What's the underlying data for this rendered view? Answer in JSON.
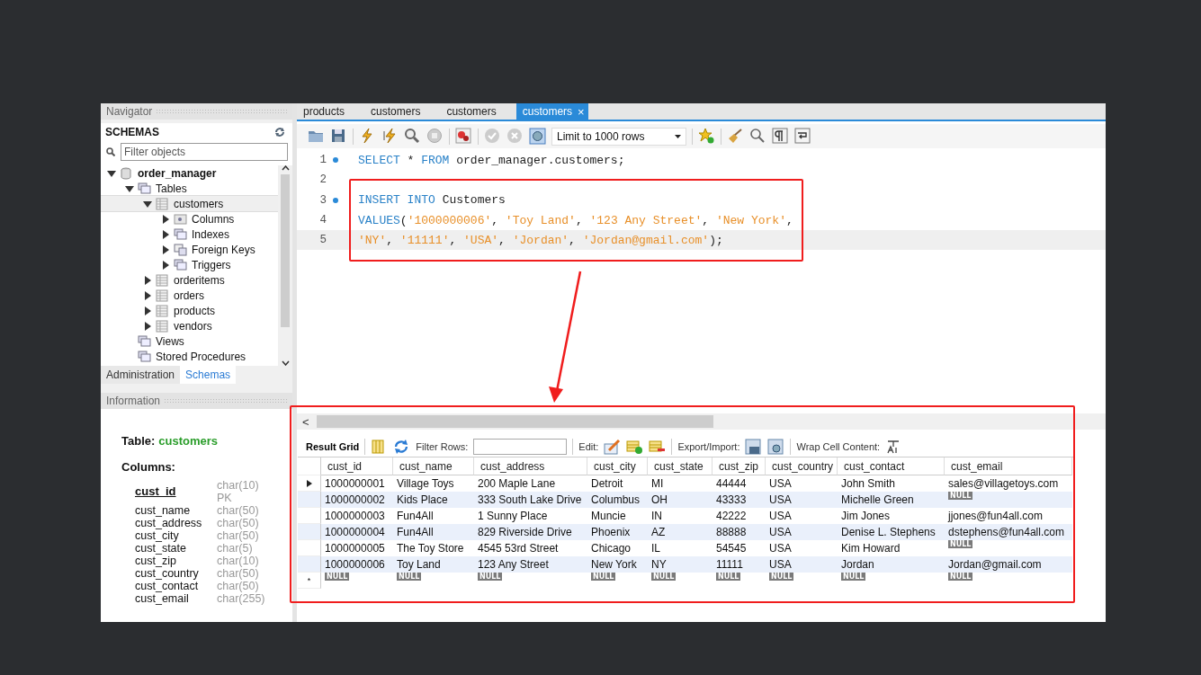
{
  "navigator": {
    "title": "Navigator",
    "section": "SCHEMAS",
    "filter": {
      "placeholder": "Filter objects"
    },
    "tree": [
      {
        "label": "order_manager",
        "kind": "schema",
        "expanded": true,
        "selected": false,
        "children": [
          {
            "label": "Tables",
            "kind": "folder",
            "expanded": true,
            "selected": false,
            "children": [
              {
                "label": "customers",
                "kind": "table",
                "expanded": true,
                "selected": true,
                "children": [
                  {
                    "label": "Columns",
                    "kind": "columns",
                    "expanded": false,
                    "selected": false
                  },
                  {
                    "label": "Indexes",
                    "kind": "folder",
                    "expanded": false,
                    "selected": false
                  },
                  {
                    "label": "Foreign Keys",
                    "kind": "keys",
                    "expanded": false,
                    "selected": false
                  },
                  {
                    "label": "Triggers",
                    "kind": "folder",
                    "expanded": false,
                    "selected": false
                  }
                ]
              },
              {
                "label": "orderitems",
                "kind": "table",
                "expanded": false,
                "selected": false
              },
              {
                "label": "orders",
                "kind": "table",
                "expanded": false,
                "selected": false
              },
              {
                "label": "products",
                "kind": "table",
                "expanded": false,
                "selected": false
              },
              {
                "label": "vendors",
                "kind": "table",
                "expanded": false,
                "selected": false
              }
            ]
          },
          {
            "label": "Views",
            "kind": "folder",
            "selected": false
          },
          {
            "label": "Stored Procedures",
            "kind": "folder",
            "selected": false
          }
        ]
      }
    ],
    "tabs": [
      {
        "label": "Administration",
        "selected": false
      },
      {
        "label": "Schemas",
        "selected": true
      }
    ]
  },
  "information": {
    "title": "Information",
    "table_label": "Table:",
    "table_name": "customers",
    "columns_label": "Columns:",
    "columns": [
      {
        "name": "cust_id",
        "type": "char(10)",
        "key": "PK",
        "primary": true
      },
      {
        "name": "cust_name",
        "type": "char(50)",
        "primary": false
      },
      {
        "name": "cust_address",
        "type": "char(50)",
        "primary": false
      },
      {
        "name": "cust_city",
        "type": "char(50)",
        "primary": false
      },
      {
        "name": "cust_state",
        "type": "char(5)",
        "primary": false
      },
      {
        "name": "cust_zip",
        "type": "char(10)",
        "primary": false
      },
      {
        "name": "cust_country",
        "type": "char(50)",
        "primary": false
      },
      {
        "name": "cust_contact",
        "type": "char(50)",
        "primary": false
      },
      {
        "name": "cust_email",
        "type": "char(255)",
        "primary": false
      }
    ]
  },
  "editor": {
    "tabs": [
      {
        "label": "products",
        "selected": false
      },
      {
        "label": "customers",
        "selected": false
      },
      {
        "label": "customers",
        "selected": false
      },
      {
        "label": "customers",
        "selected": true,
        "close": "×"
      }
    ],
    "limit": "Limit to 1000 rows",
    "lines": [
      {
        "number": "1",
        "marker": true,
        "current": false,
        "tokens": [
          {
            "kind": "keyword",
            "text": "SELECT"
          },
          {
            "kind": "plain",
            "text": " * "
          },
          {
            "kind": "keyword",
            "text": "FROM"
          },
          {
            "kind": "plain",
            "text": " order_manager.customers;"
          }
        ]
      },
      {
        "number": "2",
        "marker": false,
        "current": false
      },
      {
        "number": "3",
        "marker": true,
        "current": false,
        "tokens": [
          {
            "kind": "keyword",
            "text": "INSERT INTO"
          },
          {
            "kind": "plain",
            "text": " Customers"
          }
        ]
      },
      {
        "number": "4",
        "marker": false,
        "current": false,
        "tokens": [
          {
            "kind": "keyword",
            "text": "VALUES"
          },
          {
            "kind": "plain",
            "text": "("
          },
          {
            "kind": "string",
            "text": "'1000000006'"
          },
          {
            "kind": "plain",
            "text": ", "
          },
          {
            "kind": "string",
            "text": "'Toy Land'"
          },
          {
            "kind": "plain",
            "text": ", "
          },
          {
            "kind": "string",
            "text": "'123 Any Street'"
          },
          {
            "kind": "plain",
            "text": ", "
          },
          {
            "kind": "string",
            "text": "'New York'"
          },
          {
            "kind": "plain",
            "text": ","
          }
        ]
      },
      {
        "number": "5",
        "marker": false,
        "current": true,
        "tokens": [
          {
            "kind": "string",
            "text": "'NY'"
          },
          {
            "kind": "plain",
            "text": ", "
          },
          {
            "kind": "string",
            "text": "'11111'"
          },
          {
            "kind": "plain",
            "text": ", "
          },
          {
            "kind": "string",
            "text": "'USA'"
          },
          {
            "kind": "plain",
            "text": ", "
          },
          {
            "kind": "string",
            "text": "'Jordan'"
          },
          {
            "kind": "plain",
            "text": ", "
          },
          {
            "kind": "string",
            "text": "'Jordan@gmail.com'"
          },
          {
            "kind": "plain",
            "text": ");"
          }
        ]
      }
    ]
  },
  "result": {
    "scroll_left": "<",
    "toolbar": {
      "result_grid": "Result Grid",
      "filter_label": "Filter Rows:",
      "edit_label": "Edit:",
      "export_label": "Export/Import:",
      "wrap_label": "Wrap Cell Content:"
    },
    "columns": [
      "cust_id",
      "cust_name",
      "cust_address",
      "cust_city",
      "cust_state",
      "cust_zip",
      "cust_country",
      "cust_contact",
      "cust_email"
    ],
    "rows": [
      {
        "current": true,
        "cells": [
          "1000000001",
          "Village Toys",
          "200 Maple Lane",
          "Detroit",
          "MI",
          "44444",
          "USA",
          "John Smith",
          "sales@villagetoys.com"
        ]
      },
      {
        "current": false,
        "cells": [
          "1000000002",
          "Kids Place",
          "333 South Lake Drive",
          "Columbus",
          "OH",
          "43333",
          "USA",
          "Michelle Green",
          {
            "kind": "null",
            "text": "NULL"
          }
        ]
      },
      {
        "current": false,
        "cells": [
          "1000000003",
          "Fun4All",
          "1 Sunny Place",
          "Muncie",
          "IN",
          "42222",
          "USA",
          "Jim Jones",
          "jjones@fun4all.com"
        ]
      },
      {
        "current": false,
        "cells": [
          "1000000004",
          "Fun4All",
          "829 Riverside Drive",
          "Phoenix",
          "AZ",
          "88888",
          "USA",
          "Denise L. Stephens",
          "dstephens@fun4all.com"
        ]
      },
      {
        "current": false,
        "cells": [
          "1000000005",
          "The Toy Store",
          "4545 53rd Street",
          "Chicago",
          "IL",
          "54545",
          "USA",
          "Kim Howard",
          {
            "kind": "null",
            "text": "NULL"
          }
        ]
      },
      {
        "current": false,
        "cells": [
          "1000000006",
          "Toy Land",
          "123 Any Street",
          "New York",
          "NY",
          "11111",
          "USA",
          "Jordan",
          "Jordan@gmail.com"
        ]
      },
      {
        "current": false,
        "marker": "*",
        "cells": [
          {
            "kind": "null",
            "text": "NULL"
          },
          {
            "kind": "null",
            "text": "NULL"
          },
          {
            "kind": "null",
            "text": "NULL"
          },
          {
            "kind": "null",
            "text": "NULL"
          },
          {
            "kind": "null",
            "text": "NULL"
          },
          {
            "kind": "null",
            "text": "NULL"
          },
          {
            "kind": "null",
            "text": "NULL"
          },
          {
            "kind": "null",
            "text": "NULL"
          },
          {
            "kind": "null",
            "text": "NULL"
          }
        ]
      }
    ]
  }
}
